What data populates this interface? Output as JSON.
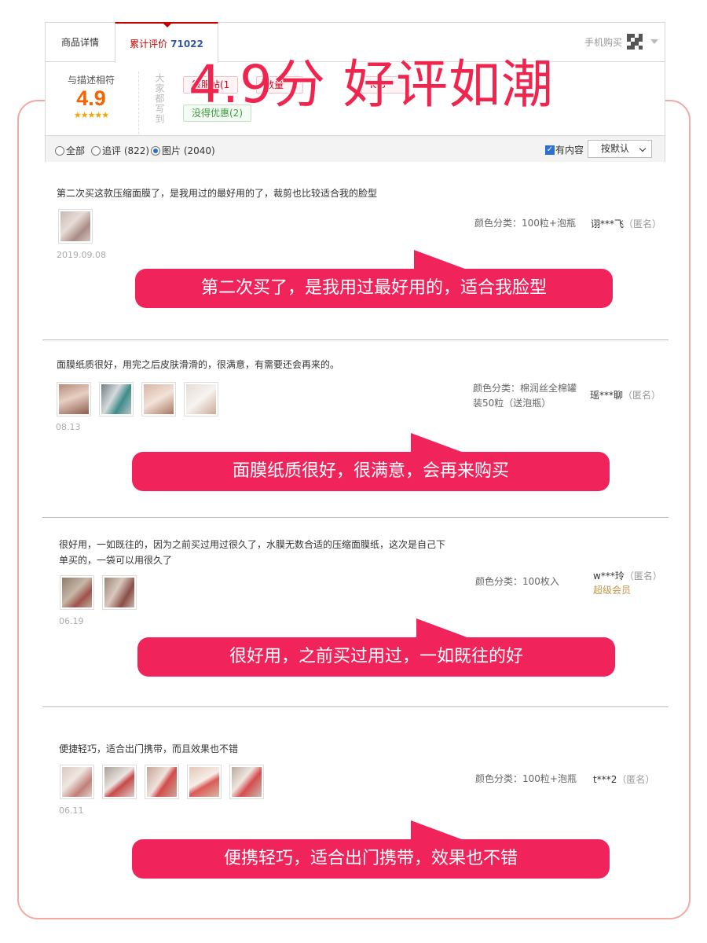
{
  "tabs": {
    "detail": "商品详情",
    "review_label": "累计评价",
    "review_count": "71022",
    "mobile_buy": "手机购买"
  },
  "rating": {
    "label": "与描述相符",
    "score": "4.9",
    "stars": "★★★★★"
  },
  "impressions": {
    "heading": "大家都写到",
    "tags_positive": [
      "很服帖(1",
      "数量",
      "K(3"
    ],
    "tags_negative": [
      "没得优惠(2)"
    ]
  },
  "headline": "4.9分 好评如潮",
  "filter": {
    "options": [
      {
        "label": "全部",
        "selected": false
      },
      {
        "label": "追评 (822)",
        "selected": false
      },
      {
        "label": "图片 (2040)",
        "selected": true
      }
    ],
    "has_content_label": "有内容",
    "has_content_checked": true,
    "sort_value": "按默认"
  },
  "reviews": [
    {
      "text": "第二次买这款压缩面膜了，是我用过的最好用的了，裁剪也比较适合我的脸型",
      "date": "2019.09.08",
      "sku_label": "颜色分类：",
      "sku_value": "100粒+泡瓶",
      "user": "诩***飞",
      "anon": "（匿名）",
      "vip": "",
      "banner": "第二次买了，是我用过最好用的，适合我脸型"
    },
    {
      "text": "面膜纸质很好，用完之后皮肤滑滑的，很满意，有需要还会再来的。",
      "date": "08.13",
      "sku_label": "颜色分类：",
      "sku_value": "棉润丝全棉罐装50粒（送泡瓶）",
      "user": "瑶***聊",
      "anon": "（匿名）",
      "vip": "",
      "banner": "面膜纸质很好，很满意，会再来购买"
    },
    {
      "text": "很好用，一如既往的，因为之前买过用过很久了，水膜无数合适的压缩面膜纸，这次是自己下单买的，一袋可以用很久了",
      "date": "06.19",
      "sku_label": "颜色分类：",
      "sku_value": "100枚入",
      "user": "w***玲",
      "anon": "（匿名）",
      "vip": "超级会员",
      "banner": "很好用，之前买过用过，一如既往的好"
    },
    {
      "text": "便捷轻巧，适合出门携带，而且效果也不错",
      "date": "06.11",
      "sku_label": "颜色分类：",
      "sku_value": "100粒+泡瓶",
      "user": "t***2",
      "anon": "（匿名）",
      "vip": "",
      "banner": "便携轻巧，适合出门携带，效果也不错"
    }
  ],
  "colors": {
    "accent_red": "#c40000",
    "banner_pink": "#f0245a",
    "frame_pink": "#f4a8a3",
    "score_orange": "#f56400"
  }
}
